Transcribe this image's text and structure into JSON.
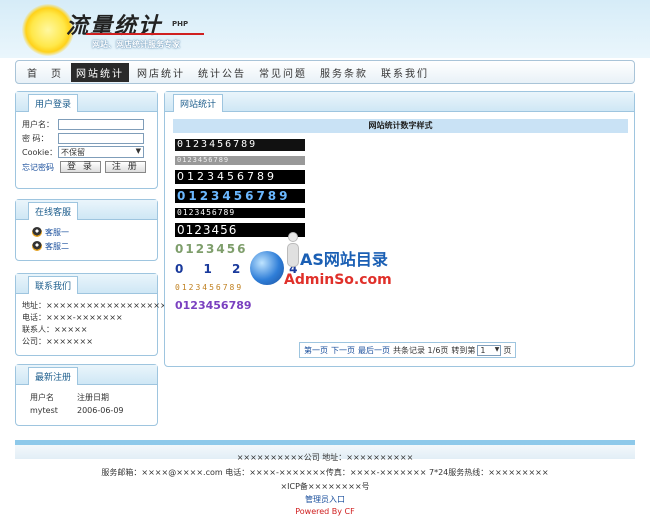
{
  "header": {
    "logo_text": "流量统计",
    "logo_suffix": "PHP",
    "slogan": "网站、网店统计服务专家"
  },
  "nav": {
    "items": [
      "首　页",
      "网站统计",
      "网店统计",
      "统计公告",
      "常见问题",
      "服务条款",
      "联系我们"
    ],
    "active_index": 1
  },
  "login": {
    "title": "用户登录",
    "username_label": "用户名：",
    "password_label": "密  码：",
    "cookie_label": "Cookie：",
    "cookie_selected": "不保留",
    "forgot_link": "忘记密码",
    "login_button": "登 录",
    "register_button": "注 册"
  },
  "support": {
    "title": "在线客服",
    "items": [
      "客服一",
      "客服二"
    ]
  },
  "contact": {
    "title": "联系我们",
    "lines": [
      "地址：××××××××××××××××××××",
      "电话：××××-×××××××",
      "联系人：×××××",
      "公司：×××××××"
    ]
  },
  "latest": {
    "title": "最新注册",
    "header": [
      "用户名",
      "注册日期"
    ],
    "rows": [
      [
        "mytest",
        "2006-06-09"
      ]
    ]
  },
  "main": {
    "tab": "网站统计",
    "heading": "网站统计数字样式",
    "samples": [
      "0123456789",
      "0123456789",
      "0123456789",
      "0123456789",
      "0123456789",
      "0123456",
      "0123456",
      "0 1 2 3 4",
      "0123456789",
      "0123456789"
    ]
  },
  "watermark": {
    "title": "AS网站目录",
    "site": "AdminSo.com"
  },
  "pager": {
    "first": "第一页",
    "prev": "下一页",
    "last": "最后一页",
    "total": "共条记录 1/6页",
    "goto": "转到第",
    "page_value": "1",
    "page_suffix": "页"
  },
  "footer": {
    "company_line": "××××××××××公司 地址：××××××××××",
    "service_line": "服务邮箱：××××@××××.com 电话：××××-×××××××传真：××××-××××××× 7*24服务热线：×××××××××",
    "icp_line": "×ICP备××××××××号",
    "admin_link": "管理员入口",
    "powered": "Powered By CF"
  }
}
